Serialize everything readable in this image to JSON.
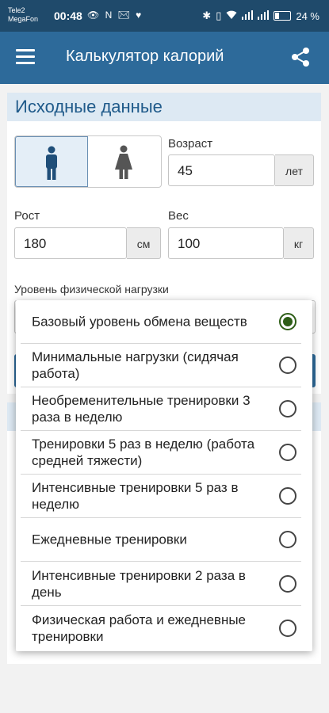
{
  "status_bar": {
    "carrier_1": "Tele2",
    "carrier_2": "MegaFon",
    "time": "00:48",
    "left_icons": "👁 N ✉ ♥",
    "battery": "24 %"
  },
  "app_bar": {
    "title": "Калькулятор калорий",
    "menu_icon": "hamburger-menu-icon",
    "share_icon": "share-icon"
  },
  "source_data": {
    "title": "Исходные данные",
    "sex_selected": "male",
    "age": {
      "label": "Возраст",
      "value": "45",
      "unit": "лет"
    },
    "height": {
      "label": "Рост",
      "value": "180",
      "unit": "см"
    },
    "weight": {
      "label": "Вес",
      "value": "100",
      "unit": "кг"
    },
    "activity_label": "Уровень физической нагрузки"
  },
  "activity_options": [
    {
      "label": "Базовый уровень обмена веществ",
      "selected": true
    },
    {
      "label": "Минимальные нагрузки (сидячая работа)",
      "selected": false
    },
    {
      "label": "Необременительные тренировки 3 раза в неделю",
      "selected": false
    },
    {
      "label": "Тренировки 5 раз в неделю (работа средней тяжести)",
      "selected": false
    },
    {
      "label": "Интенсивные тренировки 5 раз в неделю",
      "selected": false
    },
    {
      "label": "Ежедневные тренировки",
      "selected": false
    },
    {
      "label": "Интенсивные тренировки 2 раза в день",
      "selected": false
    },
    {
      "label": "Физическая работа и ежедневные тренировки",
      "selected": false
    }
  ],
  "colors": {
    "status_bar": "#1f4a6b",
    "app_bar": "#2d6a9a",
    "header_bg": "#dde9f3",
    "radio_selected": "#2e5e17"
  }
}
